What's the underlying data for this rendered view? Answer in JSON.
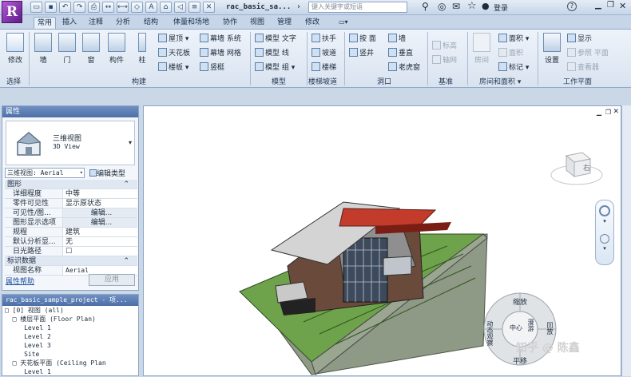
{
  "app": {
    "logo_letter": "R",
    "title": "rac_basic_sa...",
    "search_placeholder": "键入关键字或短语",
    "login": "登录",
    "help": "?"
  },
  "tabs": [
    "常用",
    "插入",
    "注释",
    "分析",
    "结构",
    "体量和场地",
    "协作",
    "视图",
    "管理",
    "修改"
  ],
  "ribbon": {
    "select": {
      "modify": "修改",
      "group": "选择"
    },
    "build": {
      "wall": "墙",
      "door": "门",
      "window": "窗",
      "component": "构件",
      "column": "柱",
      "roof": "屋顶",
      "ceiling": "天花板",
      "floor": "楼板",
      "curtain_system": "幕墙 系统",
      "curtain_grid": "幕墙 网格",
      "mullion": "竖梃",
      "group": "构建"
    },
    "model": {
      "model_text": "模型 文字",
      "model_line": "模型 线",
      "model_group": "模型 组",
      "group": "模型"
    },
    "circ": {
      "railing": "扶手",
      "ramp": "坡道",
      "stair": "楼梯",
      "group": "楼梯坡道"
    },
    "opening": {
      "by_face": "按 面",
      "shaft": "竖井",
      "wall": "墙",
      "vertical": "垂直",
      "dormer": "老虎窗",
      "group": "洞口"
    },
    "datum": {
      "level": "标高",
      "grid": "轴网",
      "group": "基准"
    },
    "room": {
      "room": "房间",
      "area": "面积",
      "area_boundary": "面积",
      "tag": "标记",
      "group": "房间和面积"
    },
    "workplane": {
      "set": "设置",
      "show": "显示",
      "ref_plane": "参照 平面",
      "viewer": "查看器",
      "group": "工作平面"
    }
  },
  "properties": {
    "title": "属性",
    "type_name": "三维视图",
    "type_sub": "3D View",
    "selector": "三维视图: Aerial",
    "edit_type": "编辑类型",
    "rows": [
      {
        "cat": "图形"
      },
      {
        "k": "详细程度",
        "v": "中等"
      },
      {
        "k": "零件可见性",
        "v": "显示原状态"
      },
      {
        "k": "可见性/图...",
        "v": "编辑..."
      },
      {
        "k": "图形显示选项",
        "v": "编辑..."
      },
      {
        "k": "规程",
        "v": "建筑"
      },
      {
        "k": "默认分析显...",
        "v": "无"
      },
      {
        "k": "日光路径",
        "v": "☐"
      },
      {
        "cat": "标识数据"
      },
      {
        "k": "视图名称",
        "v": "Aerial"
      }
    ],
    "help": "属性帮助",
    "apply": "应用"
  },
  "browser": {
    "title": "rac_basic_sample_project - 项...",
    "lines": [
      "□ [0] 视图 (all)",
      "  □ 楼层平面 (Floor Plan)",
      "     Level 1",
      "     Level 2",
      "     Level 3",
      "     Site",
      "  □ 天花板平面 (Ceiling Plan",
      "     Level 1"
    ]
  },
  "viewcube": {
    "face": "右"
  },
  "wheel": {
    "top": "缩放",
    "left": "动态观察",
    "right": "回放",
    "center": "中心",
    "look": "漫游",
    "pan": "平移"
  },
  "watermark": "知乎 @ 陈鑫"
}
